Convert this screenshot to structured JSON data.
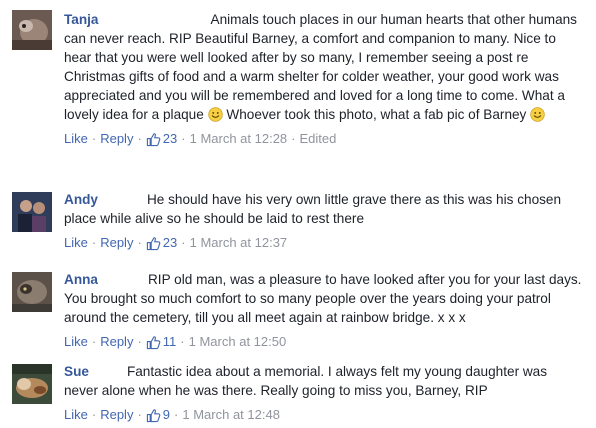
{
  "comments": [
    {
      "name": "Tanja",
      "text_parts": [
        "Animals touch places in our human hearts that other humans can never reach. RIP Beautiful Barney, a comfort and companion to many. Nice to hear that you were well looked after by so many, I remember seeing a post re Christmas gifts of food and a warm shelter for colder weather, your good work was appreciated and you will be remembered and loved for a long time to come. What a lovely idea for a plaque ",
        " Whoever took this photo, what a fab pic of Barney "
      ],
      "like_label": "Like",
      "reply_label": "Reply",
      "like_count": "23",
      "timestamp": "1 March at 12:28",
      "edited_label": "Edited"
    },
    {
      "name": "Andy",
      "text": "He should have his very own little grave there as this was his chosen place while alive so he should be laid to rest there",
      "like_label": "Like",
      "reply_label": "Reply",
      "like_count": "23",
      "timestamp": "1 March at 12:37"
    },
    {
      "name": "Anna",
      "text": "RIP old man, was a pleasure to have looked after you for your last days. You brought so much comfort to so many people over the years doing your patrol around the cemetery, till you all meet again at rainbow bridge. x x x",
      "like_label": "Like",
      "reply_label": "Reply",
      "like_count": "11",
      "timestamp": "1 March at 12:50"
    },
    {
      "name": "Sue",
      "text": "Fantastic idea about a memorial. I always felt my young daughter was never alone when he was there. Really going to miss you, Barney, RIP",
      "like_label": "Like",
      "reply_label": "Reply",
      "like_count": "9",
      "timestamp": "1 March at 12:48"
    }
  ],
  "separator": "·",
  "colors": {
    "name": "#365899",
    "link": "#4267b2",
    "meta": "#90949c",
    "text": "#1d2129"
  },
  "icons": {
    "like_count_icon": "thumbs-up-icon",
    "emoji": "smiley-icon"
  }
}
